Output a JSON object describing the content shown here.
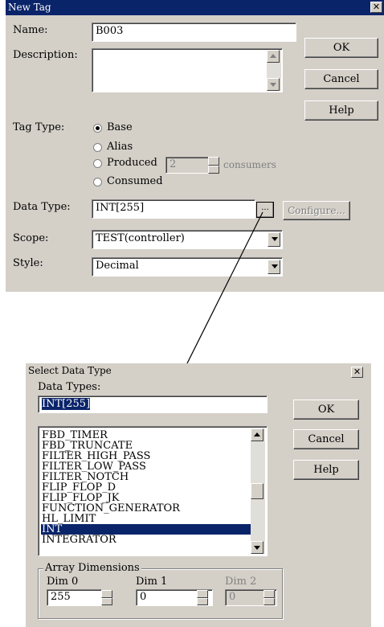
{
  "new_tag": {
    "title": "New Tag",
    "name_label": "Name:",
    "name_value": "B003",
    "description_label": "Description:",
    "tag_type_label": "Tag Type:",
    "tag_types": {
      "base": "Base",
      "alias": "Alias",
      "produced": "Produced",
      "consumed": "Consumed"
    },
    "consumers_value": "2",
    "consumers_label": "consumers",
    "data_type_label": "Data Type:",
    "data_type_value": "INT[255]",
    "browse_label": "...",
    "configure_label": "Configure...",
    "scope_label": "Scope:",
    "scope_value": "TEST(controller)",
    "style_label": "Style:",
    "style_value": "Decimal",
    "ok_label": "OK",
    "cancel_label": "Cancel",
    "help_label": "Help"
  },
  "select_data_type": {
    "title": "Select Data Type",
    "data_types_label": "Data Types:",
    "data_types_value": "INT[255]",
    "items": [
      "FBD_TIMER",
      "FBD_TRUNCATE",
      "FILTER_HIGH_PASS",
      "FILTER_LOW_PASS",
      "FILTER_NOTCH",
      "FLIP_FLOP_D",
      "FLIP_FLOP_JK",
      "FUNCTION_GENERATOR",
      "HL_LIMIT",
      "INT",
      "INTEGRATOR"
    ],
    "selected_item": "INT",
    "array_dimensions_label": "Array Dimensions",
    "dim0_label": "Dim 0",
    "dim0_value": "255",
    "dim1_label": "Dim 1",
    "dim1_value": "0",
    "dim2_label": "Dim 2",
    "dim2_value": "0",
    "ok_label": "OK",
    "cancel_label": "Cancel",
    "help_label": "Help"
  }
}
